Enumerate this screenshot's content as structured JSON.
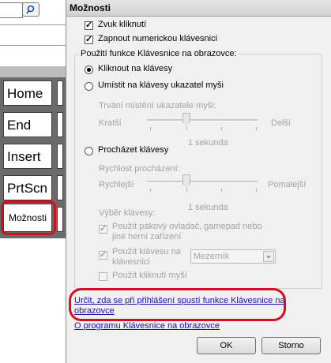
{
  "background_osk": {
    "keys": [
      "Home",
      "End",
      "Insert",
      "PrtScn"
    ],
    "options_key": "Možnosti"
  },
  "dialog": {
    "title": "Možnosti",
    "click_sound": "Zvuk kliknutí",
    "numeric_keypad": "Zapnout numerickou klávesnici",
    "group_title": "Použití funkce Klávesnice na obrazovce:",
    "mode_click": "Kliknout na klávesy",
    "mode_hover": "Umístit na klávesy ukazatel myši",
    "hover_duration": {
      "label": "Trvání místění ukazatele myši:",
      "min": "Kratší",
      "max": "Delší",
      "value": "1 sekunda"
    },
    "mode_scan": "Procházet klávesy",
    "scan_speed": {
      "label": "Rychlost procházení:",
      "min": "Rychlejší",
      "max": "Pomalejší",
      "value": "1 sekunda"
    },
    "key_select_label": "Výběr klávesy:",
    "use_joystick": "Použít pákový ovladač, gamepad nebo",
    "use_joystick_2": "jiné herní zařízení",
    "use_key": "Použít klávesu na",
    "use_key_2": "klávesnici",
    "key_dropdown_value": "Mezerník",
    "use_mouse_click": "Použít kliknutí myší",
    "link_startup_1": "Určit, zda se při přihlášení spustí funkce Klávesnice na",
    "link_startup_2": "obrazovce",
    "link_about": "O programu Klávesnice na obrazovce",
    "ok": "OK",
    "cancel": "Storno"
  },
  "colors": {
    "highlight": "#d4101f",
    "link": "#1a0dab",
    "dialog_bg": "#f0f0f0"
  }
}
